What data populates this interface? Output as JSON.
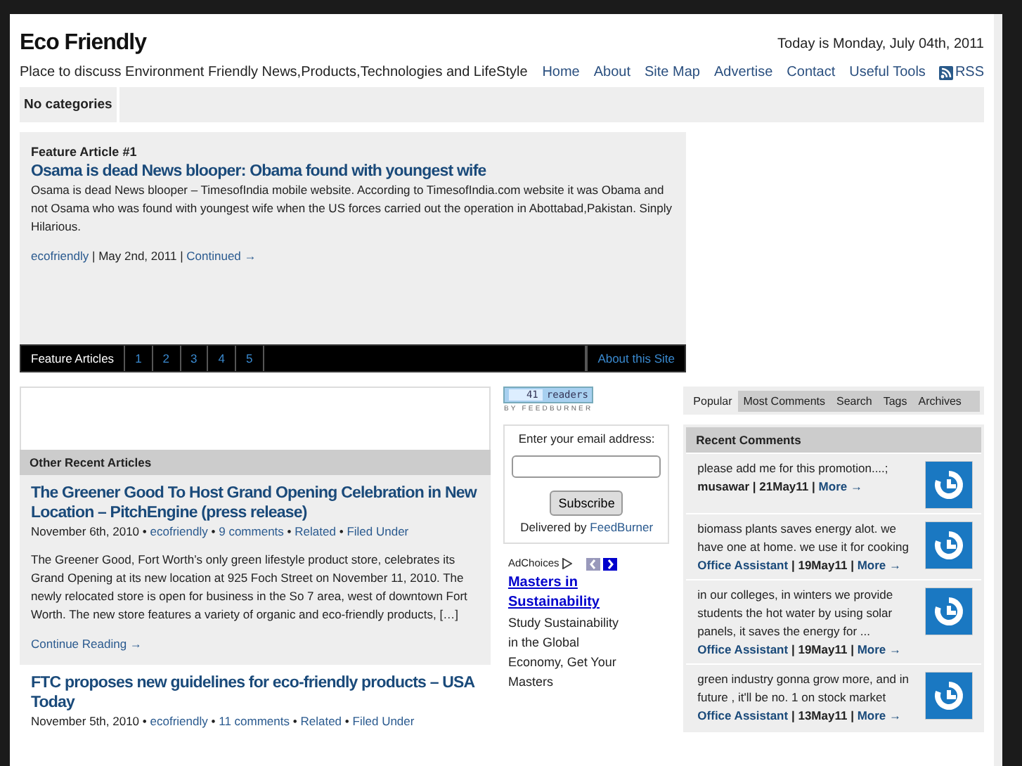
{
  "header": {
    "title": "Eco Friendly",
    "date": "Today is Monday, July 04th, 2011",
    "tagline": "Place to discuss Environment Friendly News,Products,Technologies and LifeStyle",
    "nav": [
      {
        "label": "Home"
      },
      {
        "label": "About"
      },
      {
        "label": "Site Map"
      },
      {
        "label": "Advertise"
      },
      {
        "label": "Contact"
      },
      {
        "label": "Useful Tools"
      },
      {
        "label": "RSS",
        "kind": "rss"
      }
    ]
  },
  "categories": {
    "label": "No categories"
  },
  "feature": {
    "heading": "Feature Article #1",
    "title": "Osama is dead News blooper: Obama found with youngest wife",
    "excerpt": "Osama is dead News blooper – TimesofIndia mobile website. According to TimesofIndia.com website it was Obama and not Osama who was found with youngest wife when the US forces carried out the operation in Abottabad,Pakistan. Sinply Hilarious.",
    "author": "ecofriendly",
    "separator": "|",
    "date": "May 2nd, 2011",
    "more": "Continued →",
    "nav_label": "Feature Articles",
    "pages": [
      "1",
      "2",
      "3",
      "4",
      "5"
    ],
    "about": "About this Site"
  },
  "recent": {
    "heading": "Other Recent Articles",
    "separator": "•",
    "articles": [
      {
        "title": "The Greener Good To Host Grand Opening Celebration in New Location – PitchEngine (press release)",
        "date": "November 6th, 2010",
        "author": "ecofriendly",
        "comments": "9 comments",
        "related": "Related",
        "filed": "Filed Under",
        "excerpt": "The Greener Good, Fort Worth’s only green lifestyle product store, celebrates its Grand Opening at its new location at 925 Foch Street on November 11, 2010. The newly relocated store is open for business in the So 7 area, west of downtown Fort Worth. The new store features a variety of organic and eco-friendly products, […]",
        "more": "Continue Reading →"
      },
      {
        "title": "FTC proposes new guidelines for eco-friendly products – USA Today",
        "date": "November 5th, 2010",
        "author": "ecofriendly",
        "comments": "11 comments",
        "related": "Related",
        "filed": "Filed Under"
      }
    ]
  },
  "feed": {
    "count": "41",
    "unit": "readers",
    "by": "BY FEEDBURNER",
    "prompt": "Enter your email address:",
    "button": "Subscribe",
    "delivered": "Delivered by",
    "service": "FeedBurner"
  },
  "ad": {
    "label": "AdChoices",
    "title": "Masters in Sustainability",
    "text": "Study Sustainability in the Global Economy, Get Your Masters"
  },
  "sidebar": {
    "tabs": [
      {
        "label": "Popular",
        "selected": true
      },
      {
        "label": "Most Comments",
        "selected": false
      },
      {
        "label": "Search",
        "selected": false
      },
      {
        "label": "Tags",
        "selected": false
      },
      {
        "label": "Archives",
        "selected": false
      }
    ],
    "heading": "Recent Comments",
    "separator": "|",
    "comments": [
      {
        "text": "please add me for this promotion....;",
        "author": "musawar",
        "author_link": false,
        "date": "21May11",
        "more": "More →"
      },
      {
        "text": "biomass plants saves energy alot. we have one at home. we use it for cooking",
        "author": "Office Assistant",
        "author_link": true,
        "date": "19May11",
        "more": "More →"
      },
      {
        "text": "in our colleges, in winters we provide students the hot water by using solar panels, it saves the energy for ...",
        "author": "Office Assistant",
        "author_link": true,
        "date": "19May11",
        "more": "More →"
      },
      {
        "text": "green industry gonna grow more, and in future , it'll be no. 1 on stock market",
        "author": "Office Assistant",
        "author_link": true,
        "date": "13May11",
        "more": "More →"
      }
    ]
  }
}
